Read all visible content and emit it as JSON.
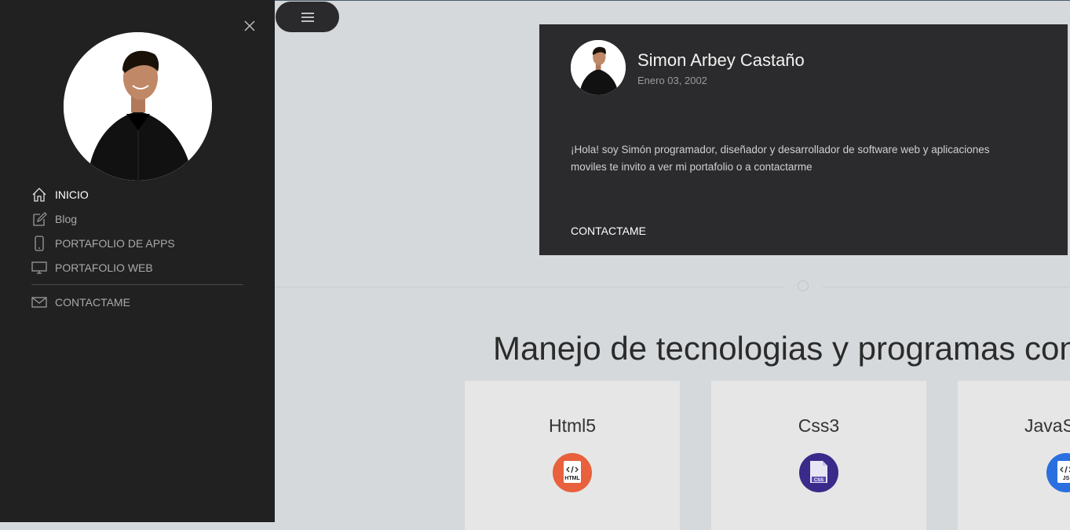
{
  "sidebar": {
    "items": [
      {
        "label": "INICIO",
        "icon": "home-icon",
        "active": true
      },
      {
        "label": "Blog",
        "icon": "edit-icon",
        "active": false
      },
      {
        "label": "PORTAFOLIO DE APPS",
        "icon": "phone-icon",
        "active": false
      },
      {
        "label": "PORTAFOLIO WEB",
        "icon": "monitor-icon",
        "active": false
      },
      {
        "label": "CONTACTAME",
        "icon": "mail-icon",
        "active": false
      }
    ]
  },
  "profile": {
    "name": "Simon Arbey Castaño",
    "date": "Enero 03, 2002",
    "bio": "¡Hola! soy Simón programador, diseñador y desarrollador de software web y aplicaciones moviles te invito a ver mi portafolio o a contactarme",
    "contact_label": "CONTACTAME"
  },
  "skills": {
    "title": "Manejo de tecnologias y programas con",
    "cards": [
      {
        "name": "Html5",
        "badge": "HTML",
        "color": "#e8603c"
      },
      {
        "name": "Css3",
        "badge": "CSS",
        "color": "#3a2a8a"
      },
      {
        "name": "JavaS",
        "badge": "JS",
        "color": "#2a6fe0"
      }
    ]
  },
  "colors": {
    "sidebar_bg": "#212121",
    "card_bg": "#2b2b2d",
    "page_bg": "#d5d9dc"
  }
}
